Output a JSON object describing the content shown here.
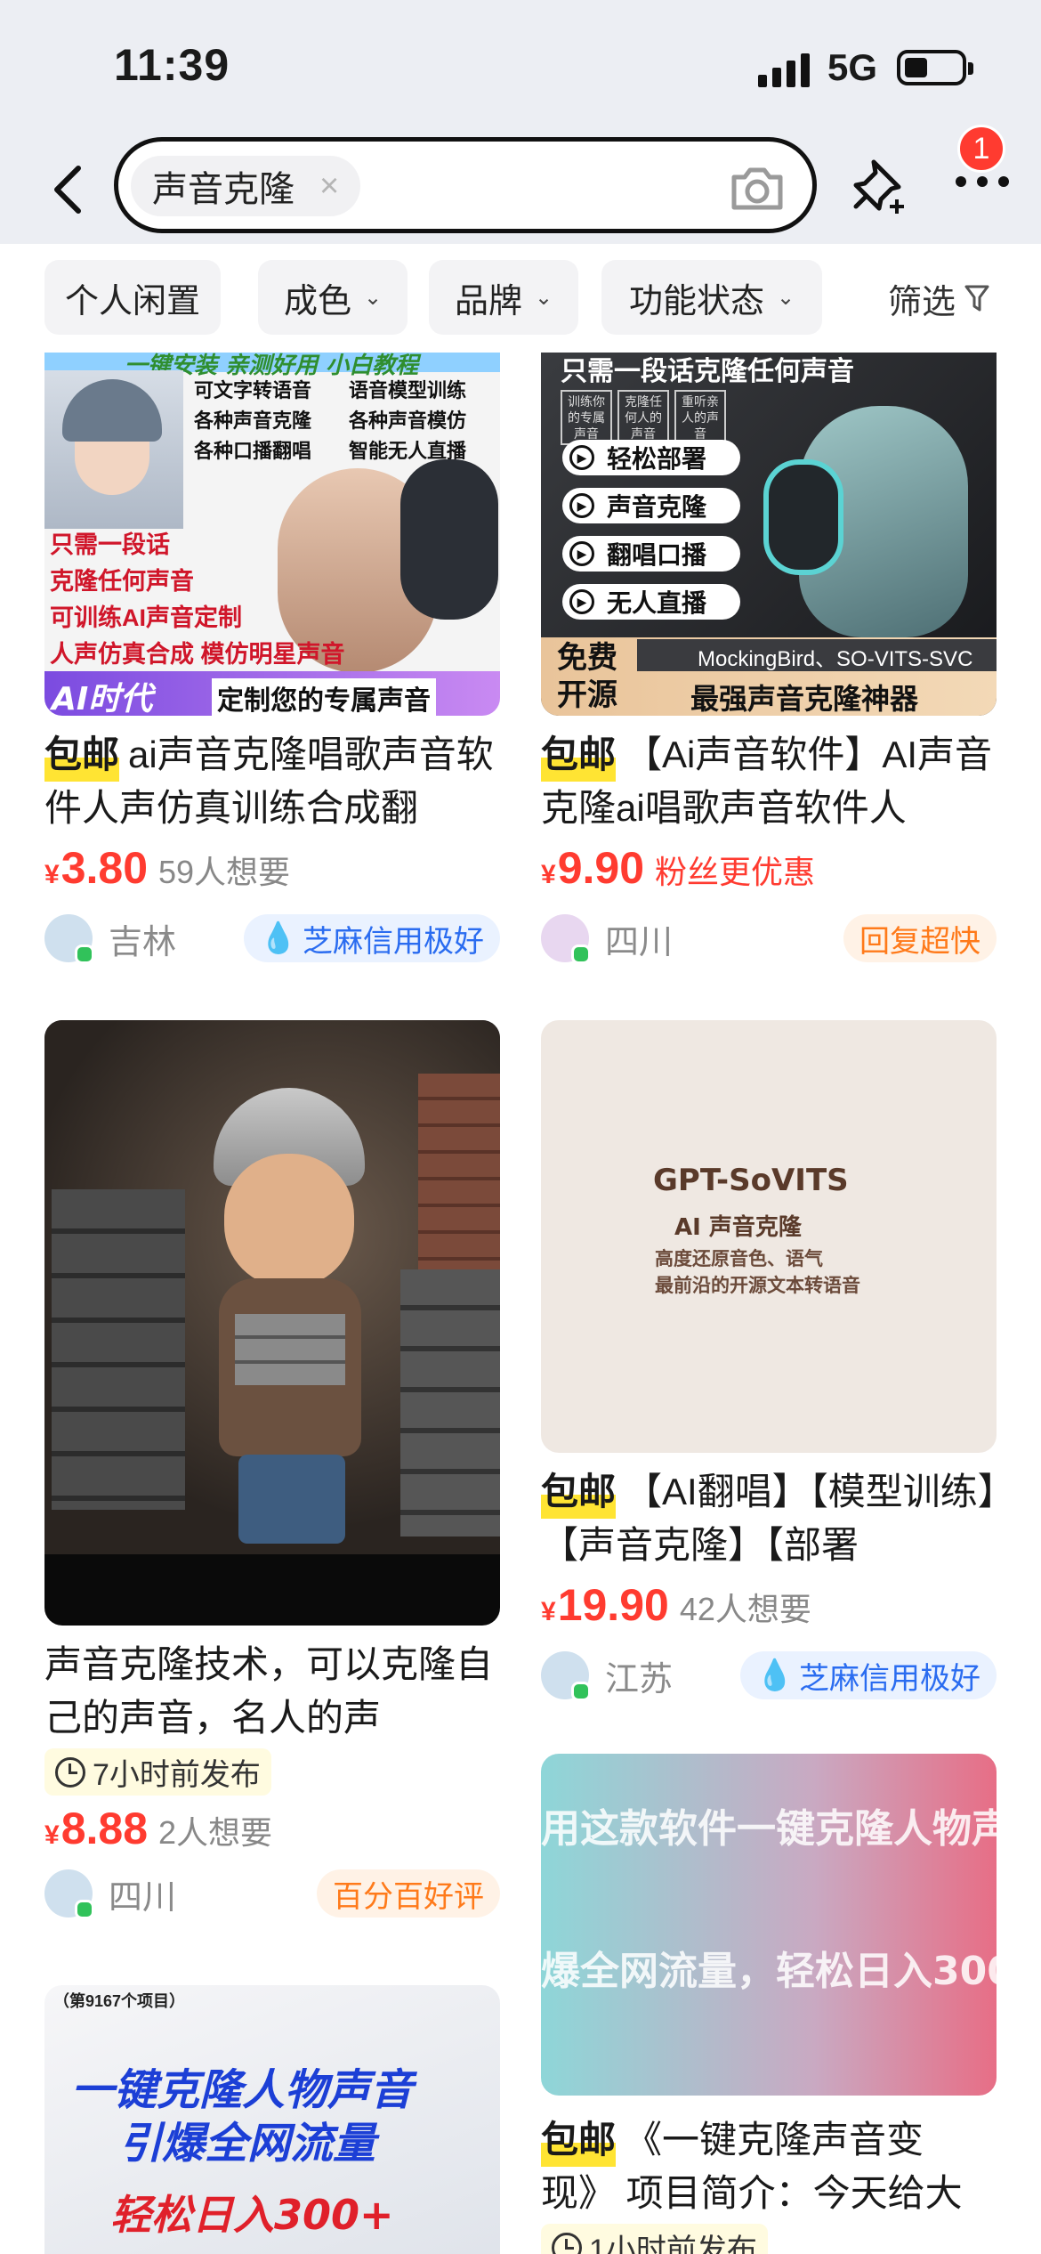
{
  "status": {
    "time": "11:39",
    "network": "5G"
  },
  "search": {
    "query": "声音克隆",
    "clear_glyph": "×"
  },
  "header": {
    "notification_count": "1"
  },
  "filters": {
    "items": [
      "个人闲置",
      "成色",
      "品牌",
      "功能状态"
    ],
    "screen_label": "筛选"
  },
  "products": [
    {
      "tag": "包邮",
      "title": "ai声音克隆唱歌声音软件人声仿真训练合成翻",
      "price": "3.80",
      "currency": "¥",
      "want": "59人想要",
      "location": "吉林",
      "badge": "芝麻信用极好",
      "poster": {
        "top": "一键安装 亲测好用 小白教程",
        "features": [
          "可文字转语音",
          "语音模型训练",
          "各种声音克隆",
          "各种声音模仿",
          "各种口播翻唱",
          "智能无人直播"
        ],
        "lines": [
          "只需一段话",
          "克隆任何声音",
          "可训练AI声音定制",
          "人声仿真合成 模仿明星声音"
        ],
        "bottom_left": "AI时代",
        "bottom_right": "定制您的专属声音"
      }
    },
    {
      "tag": "包邮",
      "title": "【Ai声音软件】AI声音克隆ai唱歌声音软件人",
      "price": "9.90",
      "currency": "¥",
      "promo": "粉丝更优惠",
      "location": "四川",
      "badge": "回复超快",
      "poster": {
        "top": "只需一段话克隆任何声音",
        "small": [
          "训练你的专属声音",
          "克隆任何人的声音",
          "重听亲人的声音"
        ],
        "buttons": [
          "轻松部署",
          "声音克隆",
          "翻唱口播",
          "无人直播"
        ],
        "free": "免费开源",
        "models": "MockingBird、SO-VITS-SVC",
        "slogan": "最强声音克隆神器"
      }
    },
    {
      "title": "声音克隆技术，可以克隆自己的声音，名人的声",
      "time": "7小时前发布",
      "price": "8.88",
      "currency": "¥",
      "want": "2人想要",
      "location": "四川",
      "badge": "百分百好评"
    },
    {
      "tag": "包邮",
      "title": "【AI翻唱】【模型训练】【声音克隆】【部署",
      "price": "19.90",
      "currency": "¥",
      "want": "42人想要",
      "location": "江苏",
      "badge": "芝麻信用极好",
      "poster": {
        "title": "GPT-SoVITS",
        "subtitle": "AI 声音克隆",
        "line1": "高度还原音色、语气",
        "line2": "最前沿的开源文本转语音"
      }
    },
    {
      "poster": {
        "line1": "（第9167个项目）",
        "line2": "一键克隆人物声音",
        "line3": "引爆全网流量",
        "line4": "轻松日入300+"
      }
    },
    {
      "tag": "包邮",
      "title": "《一键克隆声音变现》 项目简介：今天给大",
      "time": "1小时前发布",
      "poster": {
        "line1": "用这款软件一键克隆人物声",
        "line2": "爆全网流量，轻松日入300"
      }
    }
  ],
  "colors": {
    "accent": "#ff3b30",
    "tag_yellow": "#ffe433",
    "credit_blue": "#2a6cf0",
    "reply_orange": "#ff7a1a"
  },
  "icons": [
    "back-icon",
    "camera-icon",
    "pin-add-icon",
    "more-icon",
    "filter-funnel-icon",
    "clock-icon",
    "flame-icon",
    "play-icon"
  ]
}
